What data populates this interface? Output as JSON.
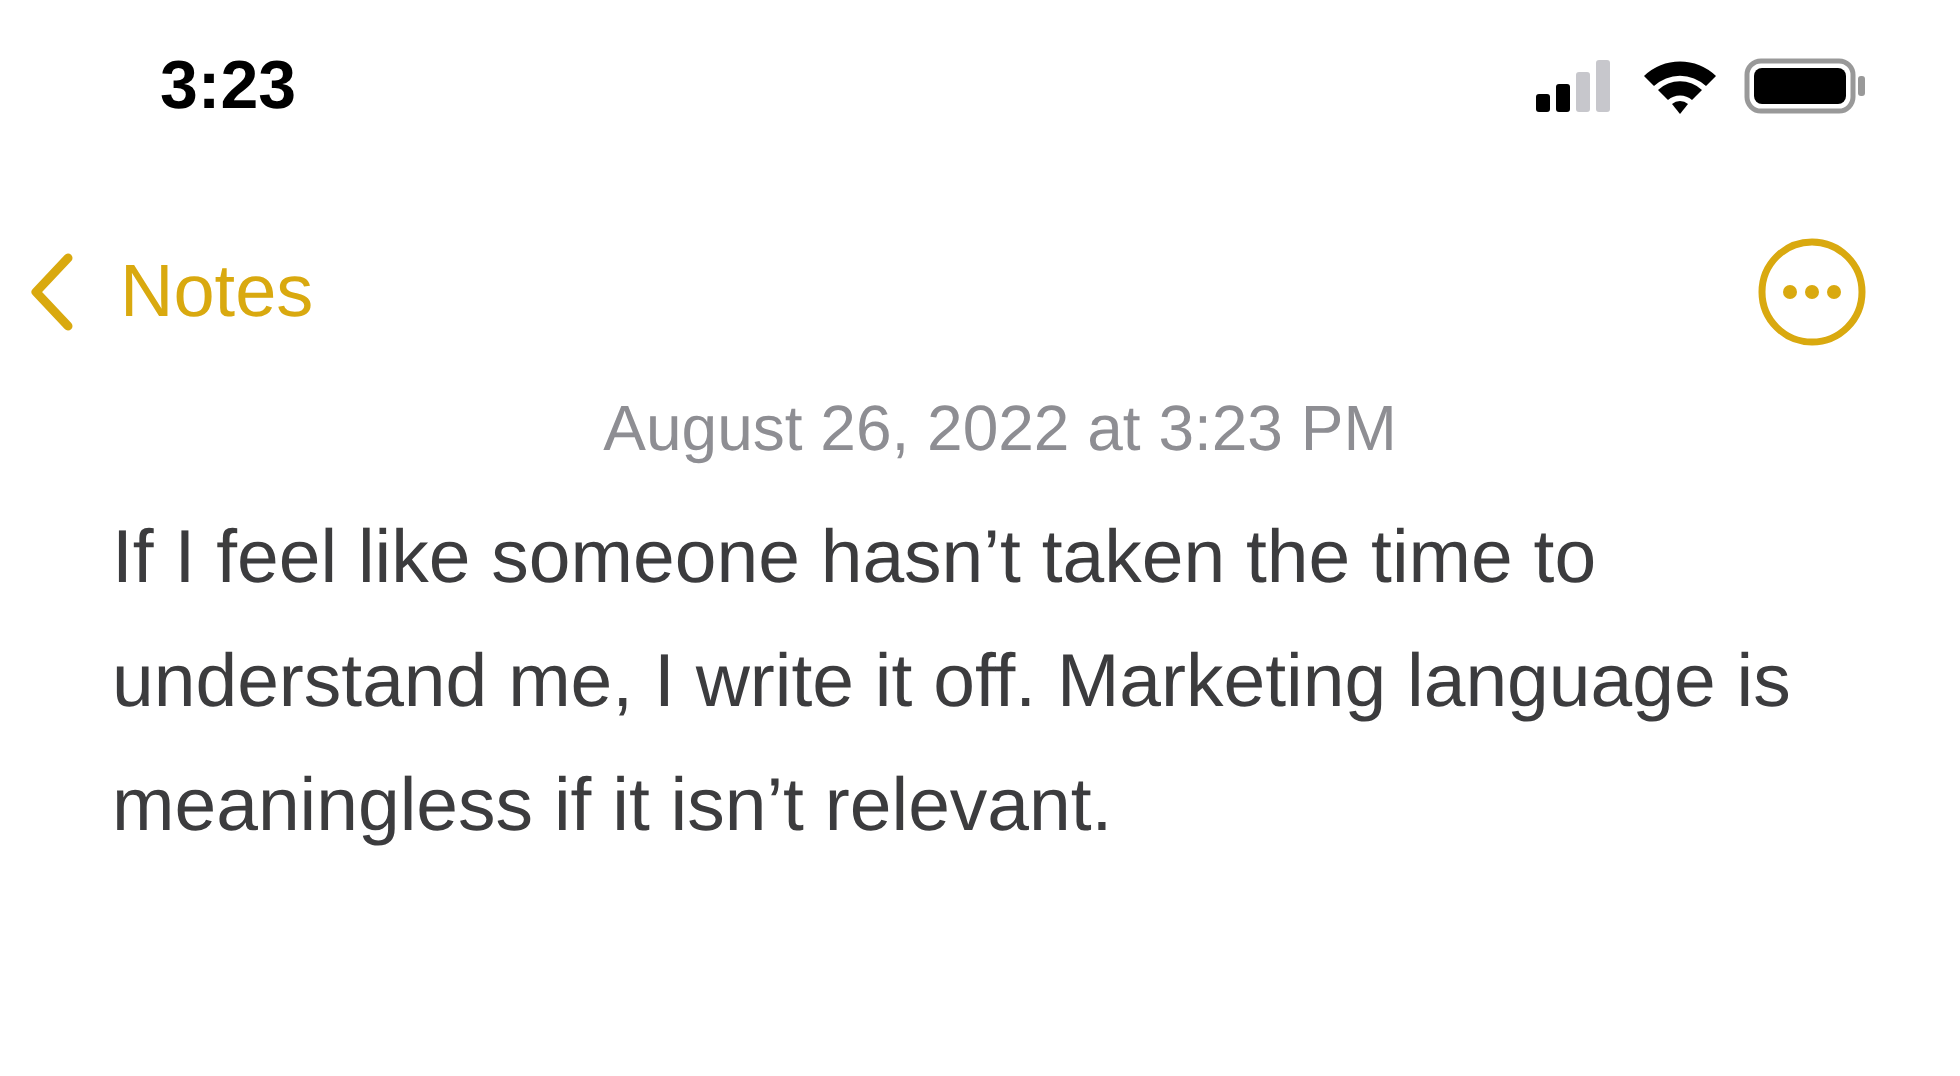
{
  "status_bar": {
    "time": "3:23"
  },
  "nav": {
    "back_label": "Notes"
  },
  "note": {
    "date": "August 26, 2022 at 3:23 PM",
    "body": "If I feel like someone hasn’t taken the time to understand me, I write it off. Marketing language is meaningless if it isn’t relevant."
  }
}
